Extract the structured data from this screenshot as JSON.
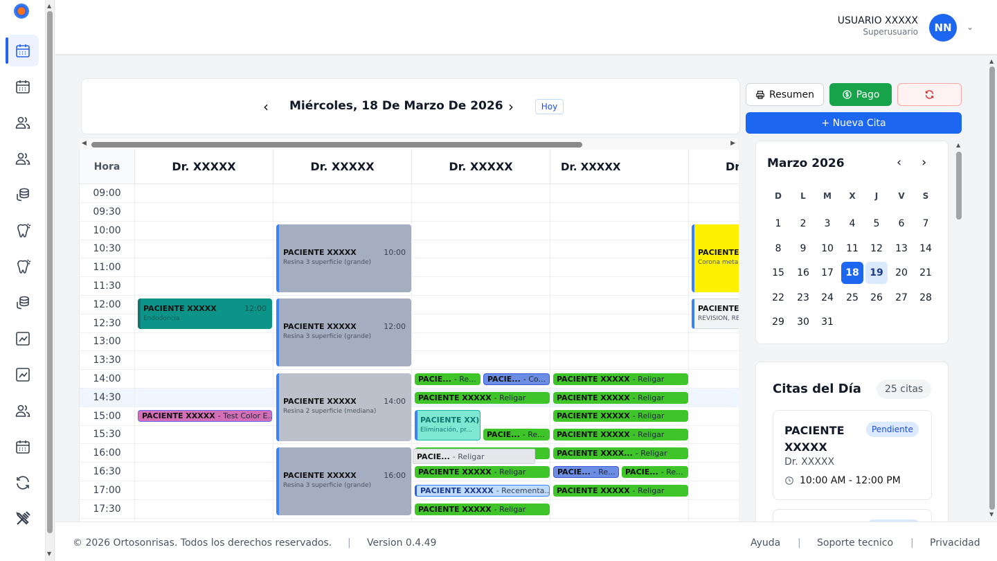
{
  "user": {
    "name": "USUARIO XXXXX",
    "role": "Superusuario",
    "initials": "NN"
  },
  "date_nav": {
    "title": "Miércoles, 18 De Marzo De 2026",
    "today_label": "Hoy"
  },
  "columns": {
    "hora": "Hora",
    "doctors": [
      "Dr. XXXXX",
      "Dr. XXXXX",
      "Dr. XXXXX",
      "Dr. XXXXX",
      "Dr"
    ]
  },
  "times": [
    "09:00",
    "09:30",
    "10:00",
    "10:30",
    "11:00",
    "11:30",
    "12:00",
    "12:30",
    "13:00",
    "13:30",
    "14:00",
    "14:30",
    "15:00",
    "15:30",
    "16:00",
    "16:30",
    "17:00",
    "17:30"
  ],
  "events": [
    {
      "patient": "PACIENTE XXXXX",
      "time": "12:00",
      "detail": "Endodoncia"
    },
    {
      "patient": "PACIENTE XXXXX",
      "detail": "- Test Color E..."
    },
    {
      "patient": "PACIENTE XXXXX",
      "time": "10:00",
      "detail": "Resina 3 superficie (grande)"
    },
    {
      "patient": "PACIENTE XXXXX",
      "time": "12:00",
      "detail": "Resina 3 superficie (grande)"
    },
    {
      "patient": "PACIENTE XXXXX",
      "time": "14:00",
      "detail": "Resina 2 superficie (mediana)"
    },
    {
      "patient": "PACIENTE XXXXX",
      "time": "16:00",
      "detail": "Resina 3 superficie (grande)"
    },
    {
      "patient": "PACIE...",
      "detail": "- Re..."
    },
    {
      "patient": "PACIE...",
      "detail": "- Co..."
    },
    {
      "patient": "PACIENTE XXXXX",
      "detail": "- Religar"
    },
    {
      "patient": "PACIENTE XX)",
      "detail": "Eliminación, pr..."
    },
    {
      "patient": "PACIE...",
      "detail": "- Re..."
    },
    {
      "patient": "PACIE...",
      "detail": "- Religar"
    },
    {
      "patient": "PACIENTE XXXXX",
      "detail": "- Religar"
    },
    {
      "patient": "PACIENTE XXXXX",
      "detail": "- Recementa..."
    },
    {
      "patient": "PACIENTE XXXXX",
      "detail": "- Religar"
    },
    {
      "patient": "PACIENTE XXXXX",
      "detail": "- Religar"
    },
    {
      "patient": "PACIENTE XXXXX",
      "detail": "- Religar"
    },
    {
      "patient": "PACIENTE XXXXX",
      "detail": "- Religar"
    },
    {
      "patient": "PACIENTE XXXXX",
      "detail": "- Religar"
    },
    {
      "patient": "PACIENTE XXXX...",
      "detail": "- Religar"
    },
    {
      "patient": "PACIE...",
      "detail": "- Re..."
    },
    {
      "patient": "PACIE...",
      "detail": "- Re..."
    },
    {
      "patient": "PACIENTE XXXXX",
      "detail": "- Religar"
    },
    {
      "patient": "PACIENTE X",
      "detail": "Corona metal"
    },
    {
      "patient": "PACIENTE X",
      "detail": "REVISION, RE"
    }
  ],
  "actions": {
    "resumen": "Resumen",
    "pago": "Pago",
    "nueva_cita": "+ Nueva Cita"
  },
  "mini_calendar": {
    "title": "Marzo 2026",
    "weekdays": [
      "D",
      "L",
      "M",
      "X",
      "J",
      "V",
      "S"
    ],
    "days": [
      "1",
      "2",
      "3",
      "4",
      "5",
      "6",
      "7",
      "8",
      "9",
      "10",
      "11",
      "12",
      "13",
      "14",
      "15",
      "16",
      "17",
      "18",
      "19",
      "20",
      "21",
      "22",
      "23",
      "24",
      "25",
      "26",
      "27",
      "28",
      "29",
      "30",
      "31"
    ],
    "selected": "18",
    "next": "19"
  },
  "citas": {
    "title": "Citas del Día",
    "count": "25 citas",
    "card": {
      "patient": "PACIENTE XXXXX",
      "status": "Pendiente",
      "doctor": "Dr. XXXXX",
      "hours": "10:00 AM - 12:00 PM"
    }
  },
  "footer": {
    "copyright": "© 2026 Ortosonrisas. Todos los derechos reservados.",
    "sep": "|",
    "version": "Version 0.4.49",
    "ayuda": "Ayuda",
    "soporte": "Soporte tecnico",
    "privacidad": "Privacidad"
  },
  "colors": {
    "primary": "#1d66f0",
    "green": "#16a34a",
    "religar": "#3fc42a",
    "teal": "#0d9488",
    "yellow": "#fff200",
    "pink": "#d36fb6"
  }
}
